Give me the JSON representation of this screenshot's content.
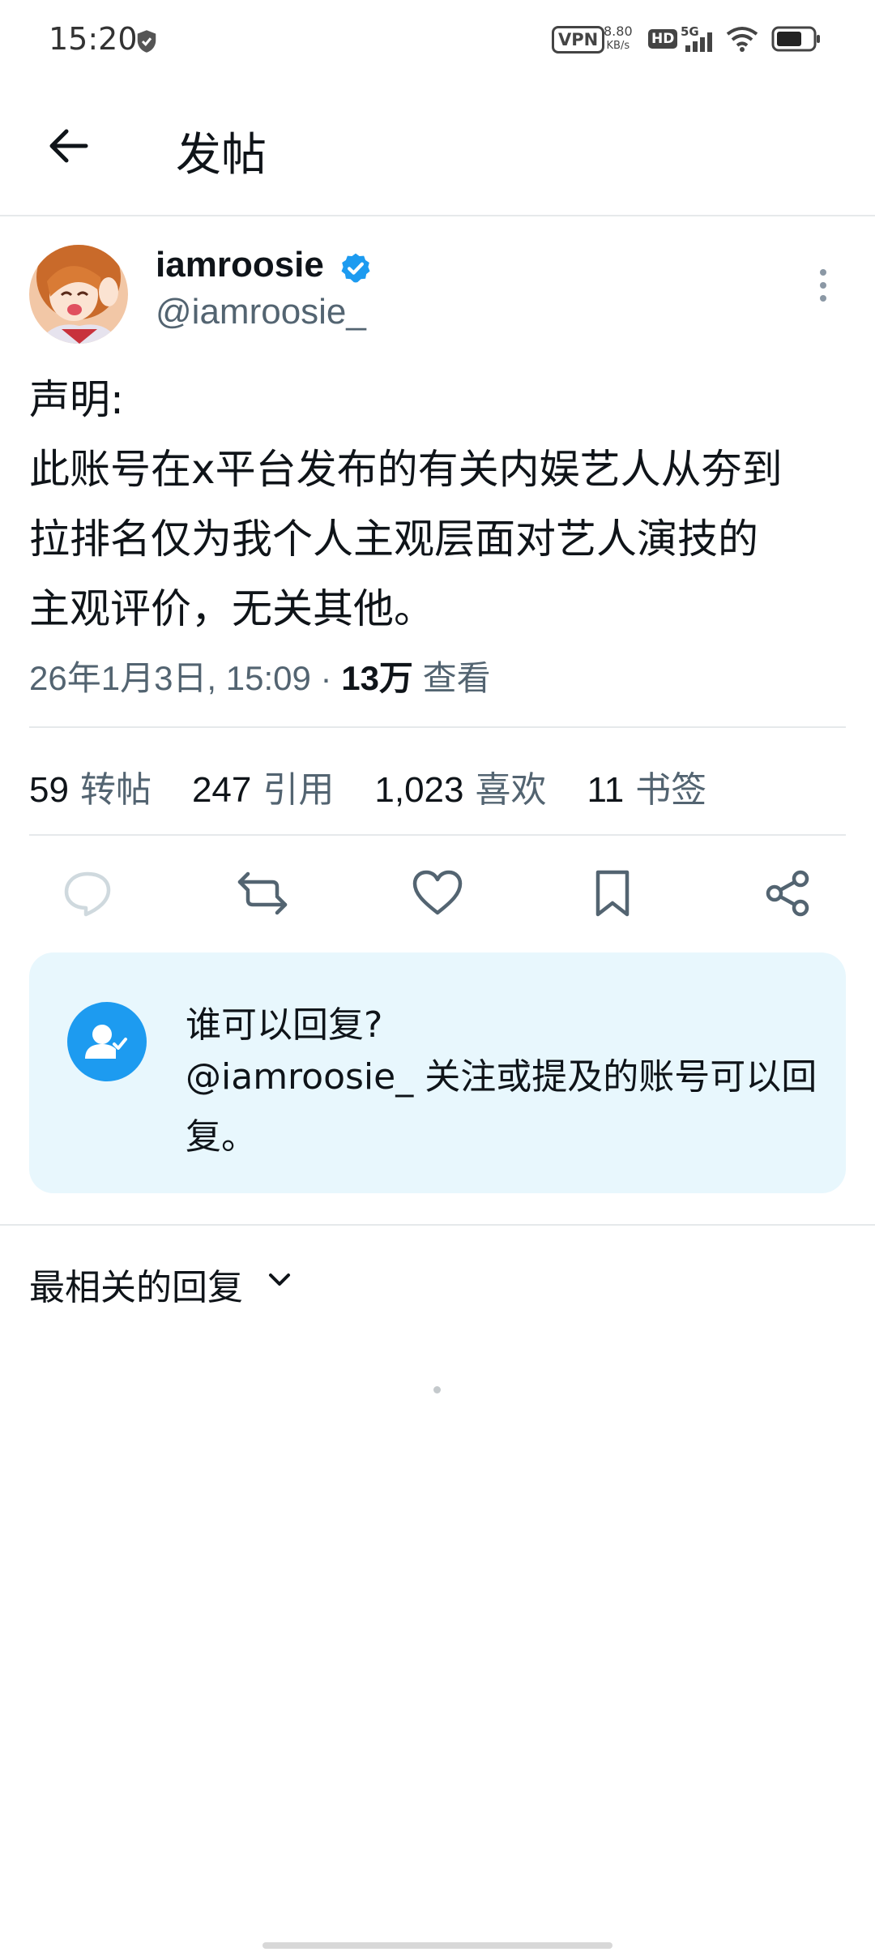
{
  "status_bar": {
    "time": "15:20",
    "vpn": "VPN",
    "net_speed_value": "8.80",
    "net_speed_unit": "KB/s",
    "hd": "HD",
    "network": "5G",
    "icons": [
      "shield-icon",
      "signal-icon",
      "wifi-icon",
      "battery-icon"
    ]
  },
  "header": {
    "title": "发帖",
    "back_icon": "arrow-left-icon"
  },
  "post": {
    "author_name": "iamroosie",
    "author_handle": "@iamroosie_",
    "verified": true,
    "body_lines": [
      "声明:",
      "此账号在x平台发布的有关内娱艺人从夯到",
      "拉排名仅为我个人主观层面对艺人演技的",
      "主观评价，无关其他。"
    ],
    "timestamp": "26年1月3日, 15:09",
    "separator": "·",
    "views_count": "13万",
    "views_label": "查看"
  },
  "stats": [
    {
      "value": "59",
      "label": "转帖"
    },
    {
      "value": "247",
      "label": "引用"
    },
    {
      "value": "1,023",
      "label": "喜欢"
    },
    {
      "value": "11",
      "label": "书签"
    }
  ],
  "actions": [
    "reply-icon",
    "repost-icon",
    "like-icon",
    "bookmark-icon",
    "share-icon"
  ],
  "reply_restriction": {
    "title": "谁可以回复?",
    "description": "@iamroosie_ 关注或提及的账号可以回复。"
  },
  "replies": {
    "sort_label": "最相关的回复"
  },
  "colors": {
    "accent": "#1d9bf0",
    "text_primary": "#0f1419",
    "text_secondary": "#536471",
    "info_bg": "#e8f7fd",
    "divider": "#e6e9eb"
  }
}
